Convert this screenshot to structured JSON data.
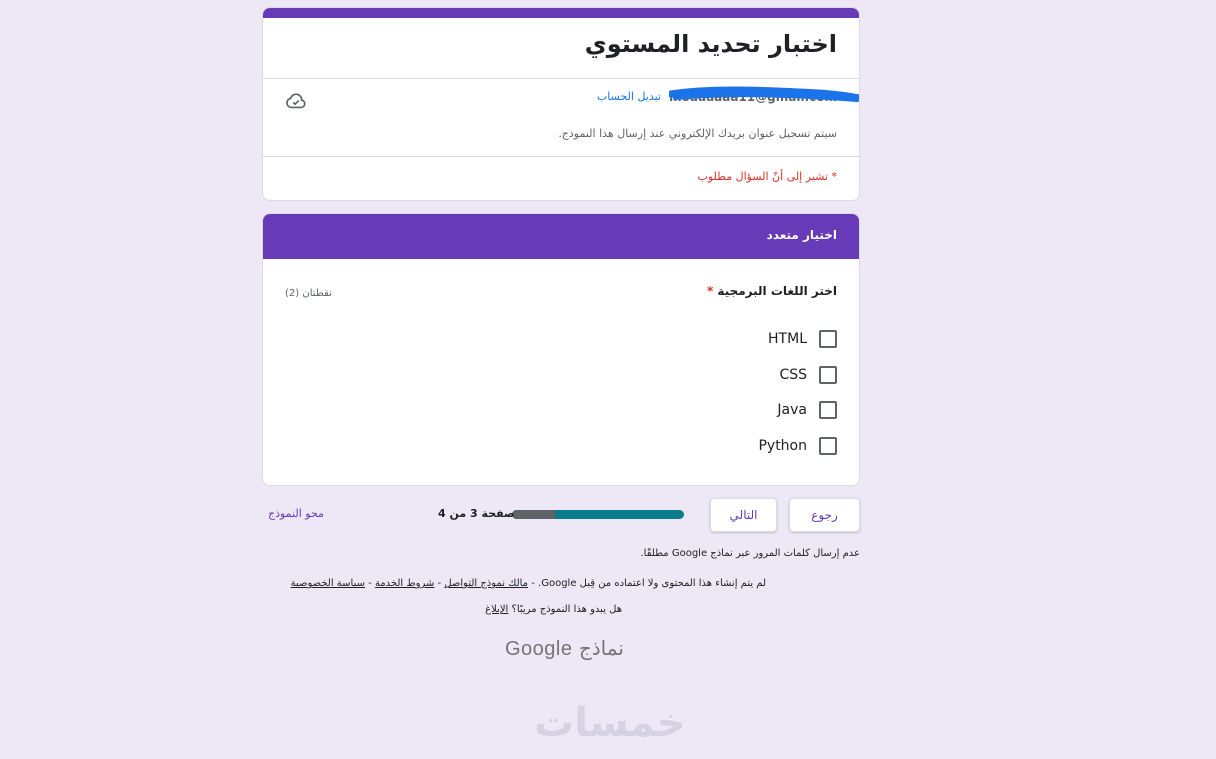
{
  "form": {
    "title": "اختبار تحديد المستوي",
    "account": {
      "email": "moaaaaaa11@gmail.com",
      "switch_label": "تبديل الحساب"
    },
    "email_note": "سيتم تسجيل عنوان بريدك الإلكتروني عند إرسال هذا النموذج.",
    "required_note": "* تشير إلى أنّ السؤال مطلوب",
    "accent_color": "#673ab7",
    "background_color": "#ede7f6"
  },
  "section": {
    "title": "اختيار متعدد",
    "question": {
      "title": "اختر اللغات البرمجية",
      "required_mark": "*",
      "points": "نقطتان (2)",
      "options": [
        "HTML",
        "CSS",
        "Java",
        "Python"
      ]
    }
  },
  "navigation": {
    "back_label": "رجوع",
    "next_label": "التالي",
    "page_text": "صفحة 3 من 4",
    "progress_fraction": 0.25,
    "clear_label": "محو النموذج"
  },
  "footer": {
    "password_note": "عدم إرسال كلمات المرور عبر نماذج Google مطلقًا.",
    "disclaimer": "لم يتم إنشاء هذا المحتوى ولا اعتماده من قِبل Google.",
    "links": [
      "مالك نموذج التواصل",
      "شروط الخدمة",
      "سياسة الخصوصية"
    ],
    "suspicious_text": "هل يبدو هذا النموذج مريبًا؟",
    "report_label": "الإبلاغ",
    "logo_google": "Google",
    "logo_forms": "نماذج"
  },
  "watermark": "خمسات"
}
